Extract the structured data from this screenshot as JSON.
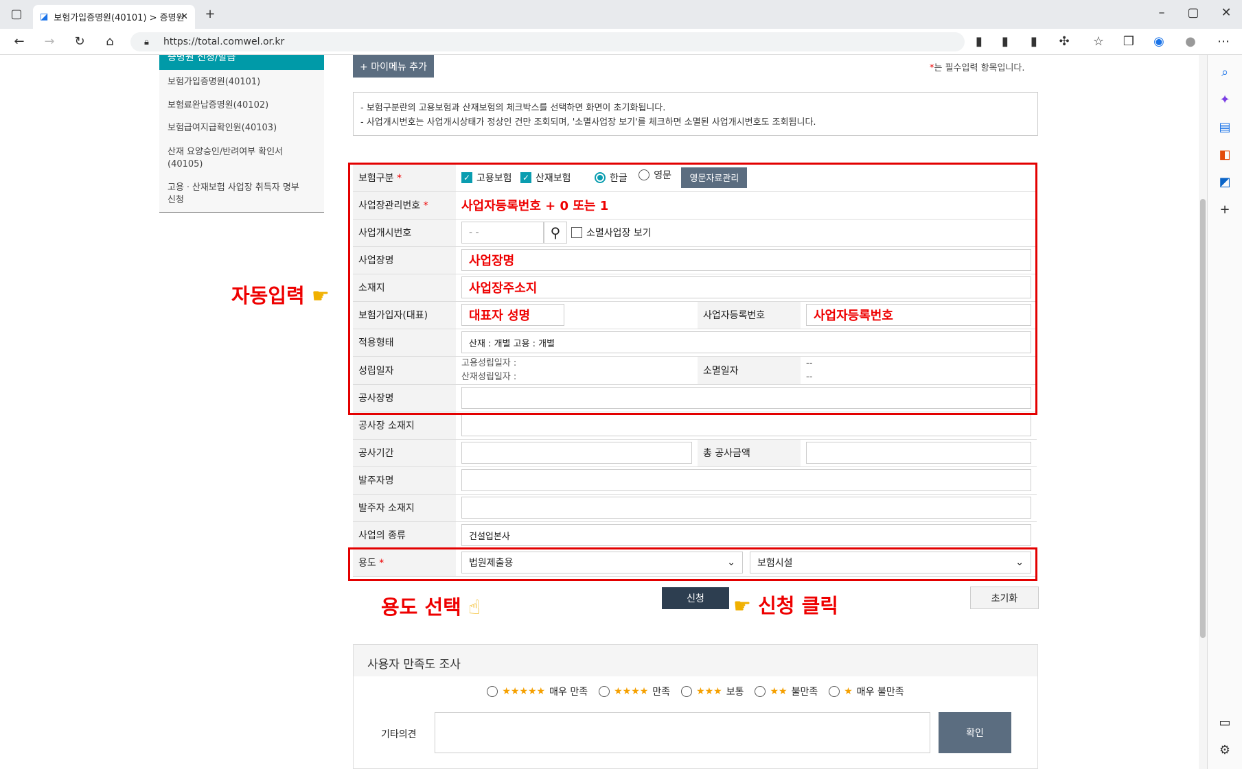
{
  "browser": {
    "tab_title": "보험가입증명원(40101) > 증명원",
    "url": "https://total.comwel.or.kr"
  },
  "sidebar": {
    "header": "증명원 신청/발급",
    "items": [
      "보험가입증명원(40101)",
      "보험료완납증명원(40102)",
      "보험급여지급확인원(40103)",
      "산재 요양승인/반려여부 확인서 (40105)",
      "고용ㆍ산재보험 사업장 취득자 명부 신청"
    ]
  },
  "page": {
    "mymenu_button": "+ 마이메뉴 추가",
    "required_note": "는 필수입력 항목입니다.",
    "required_mark": "*",
    "info_lines": [
      "- 보험구분란의 고용보험과 산재보험의 체크박스를 선택하면 화면이 초기화됩니다.",
      "- 사업개시번호는 사업개시상태가 정상인 건만 조회되며, '소멸사업장 보기'를 체크하면 소멸된 사업개시번호도 조회됩니다."
    ]
  },
  "form": {
    "insurance_type_label": "보험구분",
    "employment_ins": "고용보험",
    "industrial_ins": "산재보험",
    "lang_korean": "한글",
    "lang_english": "영문",
    "english_btn": "영문자료관리",
    "mgmt_no_label": "사업장관리번호",
    "mgmt_no_value": "사업자등록번호 + 0 또는 1",
    "start_no_label": "사업개시번호",
    "start_no_placeholder": "- -",
    "closed_view": "소멸사업장 보기",
    "biz_name_label": "사업장명",
    "biz_name_value": "사업장명",
    "location_label": "소재지",
    "location_value": "사업장주소지",
    "insured_label": "보험가입자(대표)",
    "insured_value": "대표자 성명",
    "reg_no_label": "사업자등록번호",
    "reg_no_value": "사업자등록번호",
    "apply_type_label": "적용형태",
    "apply_type_value": "산재 : 개별 고용 : 개별",
    "est_date_label": "성립일자",
    "est_emp": "고용성립일자 :",
    "est_ind": "산재성립일자 :",
    "close_date_label": "소멸일자",
    "close_val1": "--",
    "close_val2": "--",
    "site_name_label": "공사장명",
    "site_loc_label": "공사장 소재지",
    "period_label": "공사기간",
    "total_amt_label": "총 공사금액",
    "orderer_label": "발주자명",
    "orderer_loc_label": "발주자 소재지",
    "biz_kind_label": "사업의 종류",
    "biz_kind_value": "건설업본사",
    "purpose_label": "용도",
    "purpose_sel1": "법원제출용",
    "purpose_sel2": "보험시설"
  },
  "actions": {
    "apply": "신청",
    "reset": "초기화"
  },
  "annotations": {
    "auto": "자동입력",
    "purpose": "용도 선택",
    "click": "신청 클릭"
  },
  "survey": {
    "title": "사용자 만족도 조사",
    "options": [
      "매우 만족",
      "만족",
      "보통",
      "불만족",
      "매우 불만족"
    ],
    "stars": [
      "★★★★★",
      "★★★★",
      "★★★",
      "★★",
      "★"
    ],
    "comment_label": "기타의견",
    "confirm": "확인"
  }
}
